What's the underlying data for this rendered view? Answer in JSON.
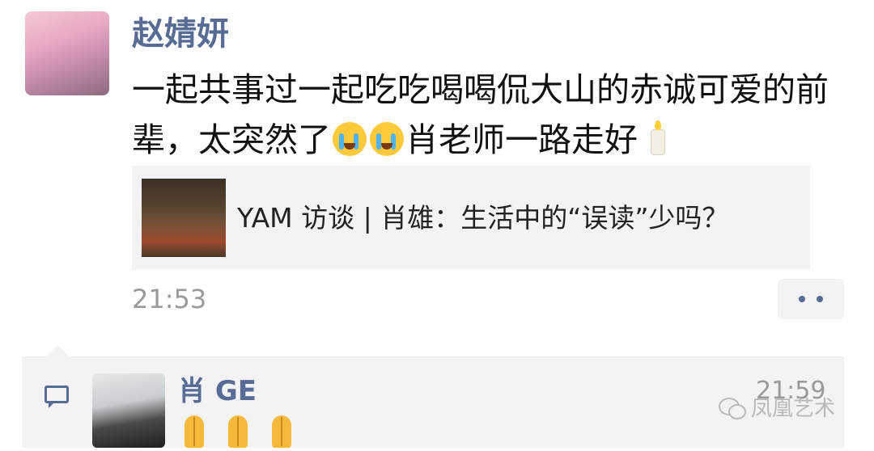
{
  "moment": {
    "author": "赵婧妍",
    "text_part1": "一起共事过一起吃吃喝喝侃大山的赤诚可爱的前辈，太突然了",
    "text_part2": "肖老师一路走好",
    "time": "21:53"
  },
  "shared_link": {
    "title": "YAM 访谈 | 肖雄：生活中的“误读”少吗？"
  },
  "comment": {
    "author": "肖 GE",
    "time": "21:59"
  },
  "watermark": {
    "text": "凤凰艺术"
  },
  "icons": {
    "crying": "loudly-crying-face-icon",
    "candle": "candle-icon",
    "pray": "folded-hands-icon",
    "comment": "comment-icon",
    "more": "more-actions-icon"
  },
  "colors": {
    "name": "#576b95",
    "meta": "#9a9a9a",
    "card_bg": "#f3f3f5"
  }
}
